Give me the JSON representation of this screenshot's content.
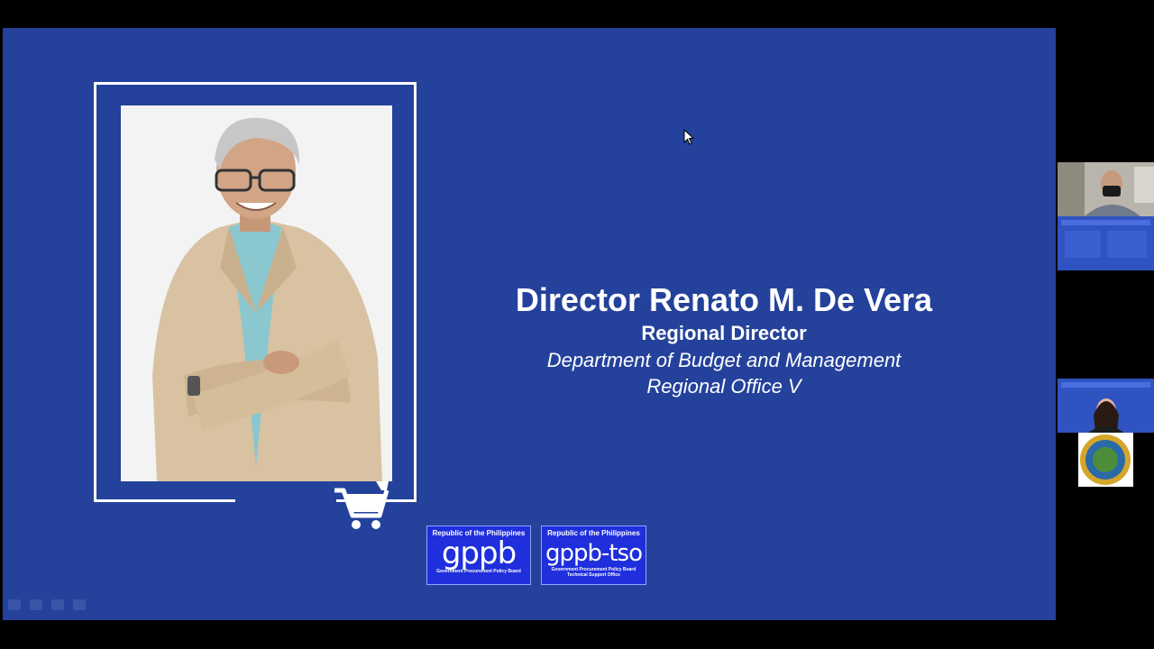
{
  "slide": {
    "name": "Director Renato M. De Vera",
    "role": "Regional Director",
    "department": "Department of Budget and Management",
    "office": "Regional Office V"
  },
  "logos": {
    "gppb": {
      "country": "Republic of the Philippines",
      "mark": "gppb",
      "subtitle": "Government Procurement Policy Board"
    },
    "gppb_tso": {
      "country": "Republic of the Philippines",
      "mark": "gppb-tso",
      "subtitle_line1": "Government Procurement Policy Board",
      "subtitle_line2": "Technical Support Office"
    }
  },
  "icons": {
    "cart": "shopping-cart-icon",
    "cursor": "mouse-pointer-icon"
  },
  "colors": {
    "slide_bg": "#24429b",
    "logo_bg": "#1f2fdc",
    "text": "#ffffff"
  }
}
